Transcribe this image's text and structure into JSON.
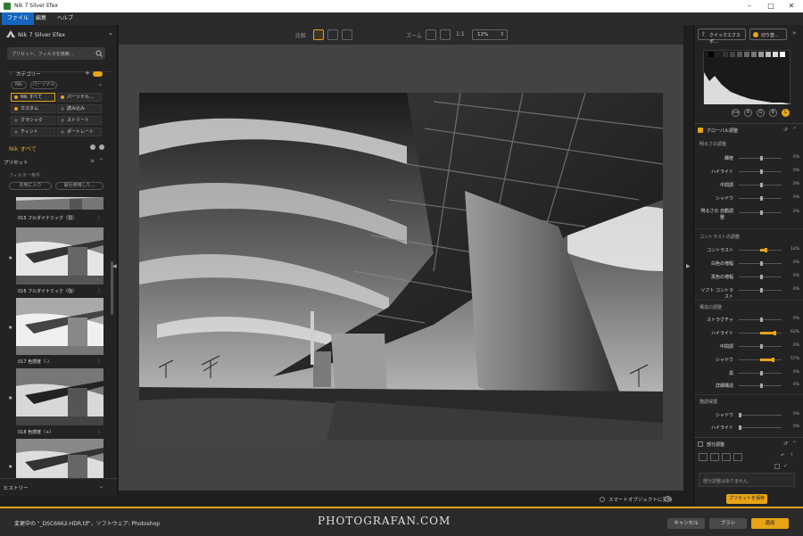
{
  "window": {
    "title": "Nik 7 Silver Efex",
    "controls": [
      "–",
      "□",
      "✕"
    ]
  },
  "menu": [
    "ファイル",
    "編集",
    "ヘルプ"
  ],
  "left": {
    "app_name": "Nik 7 Silver Efex",
    "search_placeholder": "プリセット、フィルタを検索...",
    "category_title": "カテゴリー",
    "tabs": [
      "Nik",
      "パーソナル"
    ],
    "categories": [
      "Nik すべて",
      "パーソナル...",
      "カスタム",
      "読み込み",
      "クラシック",
      "ストリート",
      "ティント",
      "ポートレート"
    ],
    "selected_category": "Nik すべて",
    "presets_title": "プリセット",
    "filter_label": "フィルター条件",
    "filter_buttons": [
      "お気に入り",
      "最近使用した..."
    ],
    "thumbs": [
      "015 フルダイナミック（弱）",
      "016 フルダイナミック（強）",
      "017 色感度（-）",
      "018 色感度（+）"
    ],
    "history": "ヒストリー"
  },
  "toolbar": {
    "compare": "比較",
    "zoom": "ズーム",
    "zoom_ratio": "1:1",
    "zoom_value": "12%"
  },
  "canvas": {
    "smart_object": "スマートオブジェクトに変換"
  },
  "right": {
    "quick_export": "クイックエクスポ...",
    "switch": "切り替...",
    "channels": [
      "RGB",
      "R",
      "G",
      "B",
      "L"
    ],
    "global": "グローバル調整",
    "brightness": "明るさの調整",
    "brightness_rows": [
      {
        "label": "輝度",
        "value": "0%"
      },
      {
        "label": "ハイライト",
        "value": "0%"
      },
      {
        "label": "中間調",
        "value": "0%"
      },
      {
        "label": "シャドウ",
        "value": "0%"
      }
    ],
    "auto_label_1": "明るさの 自動調",
    "auto_label_2": "整",
    "auto_value": "0%",
    "contrast": "コントラストの調整",
    "contrast_rows": [
      {
        "label": "コントラスト",
        "value": "12%"
      },
      {
        "label": "白色の増幅",
        "value": "0%"
      },
      {
        "label": "黒色の増幅",
        "value": "0%"
      },
      {
        "label": "ソフト コントラスト",
        "value": "0%"
      }
    ],
    "structure": "構造の調整",
    "structure_rows": [
      {
        "label": "ストラクチャ",
        "value": "0%"
      },
      {
        "label": "ハイライト",
        "value": "63%"
      },
      {
        "label": "中間調",
        "value": "0%"
      },
      {
        "label": "シャドウ",
        "value": "57%"
      },
      {
        "label": "黒",
        "value": "0%"
      },
      {
        "label": "詳細構造",
        "value": "0%"
      }
    ],
    "protect": "階調保護",
    "protect_rows": [
      {
        "label": "シャドウ",
        "value": "0%"
      },
      {
        "label": "ハイライト",
        "value": "0%"
      }
    ],
    "local": "部分調整",
    "local_empty": "部分調整はありません",
    "save_preset": "プリセットを保存"
  },
  "status": {
    "text": "変更中の \"_DSC6662-HDR.tif\"，ソフトウェア: Photoshop",
    "watermark": "PHOTOGRAFAN.COM",
    "cancel": "キャンセル",
    "brush": "ブラシ",
    "apply": "適用"
  },
  "colors": {
    "accent": "#e8a317",
    "menu_active": "#1565c0"
  }
}
